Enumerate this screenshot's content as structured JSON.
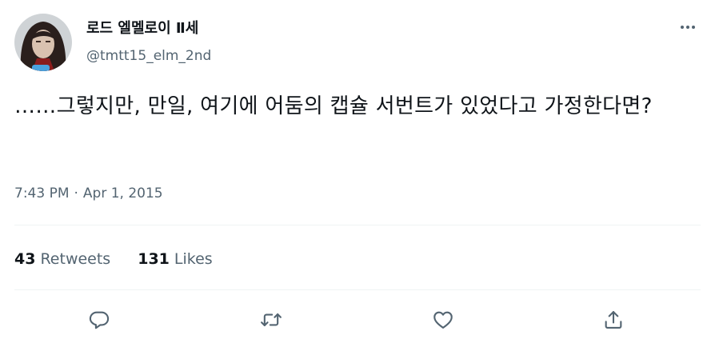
{
  "author": {
    "display_name": "로드 엘멜로이 Ⅱ세",
    "handle": "@tmtt15_elm_2nd",
    "avatar": "avatar-image"
  },
  "tweet": {
    "text": "……그렇지만, 만일, 여기에 어둠의 캡슐 서번트가 있었다고 가정한다면?",
    "time": "7:43 PM",
    "separator": "·",
    "date": "Apr 1, 2015"
  },
  "stats": {
    "retweets_count": "43",
    "retweets_label": "Retweets",
    "likes_count": "131",
    "likes_label": "Likes"
  },
  "icons": {
    "more": "more-horizontal-icon",
    "reply": "reply-icon",
    "retweet": "retweet-icon",
    "like": "heart-icon",
    "share": "share-icon"
  },
  "colors": {
    "text": "#0f1419",
    "secondary": "#536471",
    "divider": "#eff3f4"
  }
}
